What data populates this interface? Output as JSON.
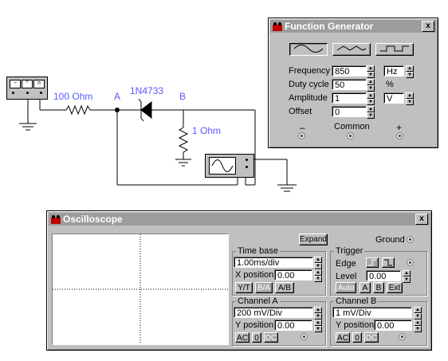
{
  "circuit": {
    "resistor1_label": "100 Ohm",
    "node_a": "A",
    "diode_label": "1N4733",
    "node_b": "B",
    "resistor2_label": "1 Ohm"
  },
  "function_generator": {
    "title": "Function Generator",
    "close_label": "x",
    "waveforms": [
      "sine",
      "triangle",
      "square"
    ],
    "frequency_label": "Frequency",
    "frequency_value": "850",
    "frequency_unit": "Hz",
    "duty_label": "Duty cycle",
    "duty_value": "50",
    "duty_unit": "%",
    "amplitude_label": "Amplitude",
    "amplitude_value": "1",
    "amplitude_unit": "V",
    "offset_label": "Offset",
    "offset_value": "0",
    "minus_label": "–",
    "common_label": "Common",
    "plus_label": "+"
  },
  "oscilloscope": {
    "title": "Oscilloscope",
    "close_label": "x",
    "expand_label": "Expand",
    "ground_label": "Ground",
    "timebase": {
      "title": "Time base",
      "value": "1.00ms/div",
      "xpos_label": "X position",
      "xpos_value": "0.00",
      "yt_label": "Y/T",
      "ba_label": "B/A",
      "ab_label": "A/B"
    },
    "trigger": {
      "title": "Trigger",
      "edge_label": "Edge",
      "level_label": "Level",
      "level_value": "0.00",
      "auto_label": "Auto",
      "a_label": "A",
      "b_label": "B",
      "ext_label": "Ext"
    },
    "channel_a": {
      "title": "Channel A",
      "value": "200 mV/Div",
      "ypos_label": "Y position",
      "ypos_value": "0.00",
      "ac_label": "AC",
      "zero_label": "0",
      "dc_label": "DC"
    },
    "channel_b": {
      "title": "Channel B",
      "value": " 1 mV/Div",
      "ypos_label": "Y position",
      "ypos_value": "0.00",
      "ac_label": "AC",
      "zero_label": "0",
      "dc_label": "DC"
    }
  },
  "colors": {
    "wire": "#000000",
    "label": "#5a5aff",
    "window_bg": "#c0c0c0",
    "titlebar": "#9c9c9c"
  }
}
